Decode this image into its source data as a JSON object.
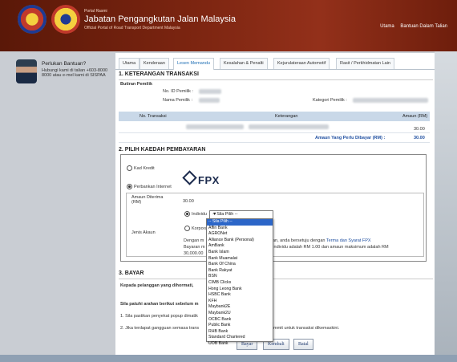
{
  "header": {
    "portal_small": "Portal Rasmi",
    "title": "Jabatan Pengangkutan Jalan Malaysia",
    "subtitle": "Official Portal of Road Transport Department Malaysia",
    "nav": [
      "Utama",
      "Bantuan Dalam Talian"
    ]
  },
  "sidebar": {
    "help_title": "Perlukan Bantuan?",
    "help_body": "Hubungi kami di talian +603-8000 8000 atau e-mel kami di SISPAA"
  },
  "tabs": [
    "Utama",
    "Kenderaan",
    "Lesen Memandu",
    "Kesalahan & Penalti",
    "Kejurulateraan Automotif",
    "Rasit / Perkhidmatan Lain"
  ],
  "active_tab_index": 2,
  "section1": {
    "title": "1. KETERANGAN TRANSAKSI",
    "subtitle": "Butiran Pemilik",
    "id_label": "No. ID Pemilik :",
    "name_label": "Nama Pemilik :",
    "category_label": "Kategori Pemilik :"
  },
  "table": {
    "headers": [
      "No. Transaksi",
      "Keterangan",
      "Amaun (RM)"
    ],
    "row_amount": "30.00",
    "total_label": "Amaun Yang Perlu Dibayar (RM) :",
    "total_value": "30.00"
  },
  "section2": {
    "title": "2. PILIH KAEDAH PEMBAYARAN",
    "option_credit": "Kad Kredit",
    "option_internet": "Perbankan Internet",
    "fpx": "FPX",
    "amount_label": "Amaun Diterima (RM)",
    "amount_value": "30.00",
    "account_label": "Jenis Akaun",
    "individu": "Individu",
    "korporat": "Korporat",
    "select_value": "-- Sila Pilih --",
    "note_line1a": "Dengan m",
    "note_line1b": "an, anda bersetuju dengan",
    "note_link": "Terma dan Syarat FPX",
    "note_line2a": "Bayaran m",
    "note_line2b": "Individu adalah RM 1.00 dan amaun maksimum adalah RM",
    "note_line3": "30,000.00"
  },
  "banks": [
    "-- Sila Pilih --",
    "Affin Bank",
    "AGRONet",
    "Alliance Bank (Personal)",
    "AmBank",
    "Bank Islam",
    "Bank Muamalat",
    "Bank Of China",
    "Bank Rakyat",
    "BSN",
    "CIMB Clicks",
    "Hong Leong Bank",
    "HSBC Bank",
    "KFH",
    "Maybank2E",
    "Maybank2U",
    "OCBC Bank",
    "Public Bank",
    "RHB Bank",
    "Standard Chartered",
    "UOB Bank"
  ],
  "section3": {
    "title": "3. BAYAR",
    "greeting": "Kepada pelanggan yang dihormati,",
    "instruct": "Sila patuhi arahan berikut sebelum m",
    "step1": "1. Sila pastikan penyekat popup dimatik",
    "step2": "2. Jika terdapat gangguan semasa trans",
    "step2b": "mmit untuk transaksi dikemaskini."
  },
  "buttons": {
    "pay": "Bayar",
    "back": "Kembali",
    "cancel": "Batal"
  }
}
